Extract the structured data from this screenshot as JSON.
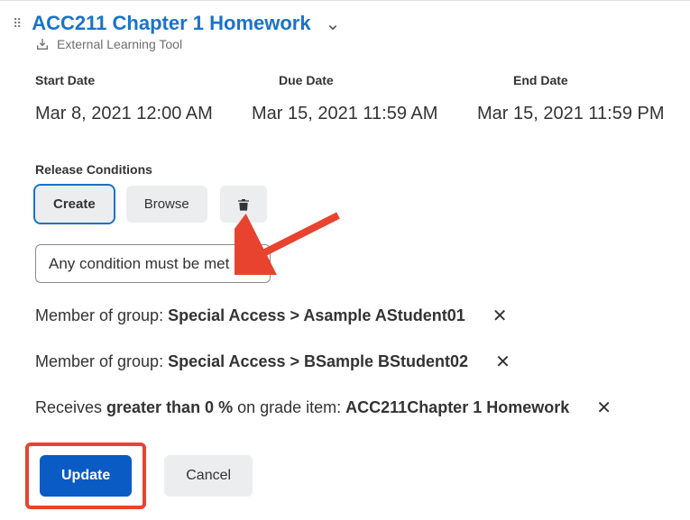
{
  "header": {
    "title": "ACC211 Chapter 1 Homework",
    "subtype": "External Learning Tool"
  },
  "dates": {
    "start_label": "Start Date",
    "due_label": "Due Date",
    "end_label": "End Date",
    "start_value": "Mar 8, 2021 12:00 AM",
    "due_value": "Mar 15, 2021 11:59 AM",
    "end_value": "Mar 15, 2021 11:59 PM"
  },
  "release": {
    "label": "Release Conditions",
    "create_label": "Create",
    "browse_label": "Browse",
    "dropdown_value": "Any condition must be met",
    "conditions": [
      {
        "prefix": "Member of group: ",
        "bold": "Special Access > Asample AStudent01"
      },
      {
        "prefix": "Member of group: ",
        "bold": "Special Access > BSample BStudent02"
      },
      {
        "prefix": "Receives ",
        "bold": "greater than 0 %",
        "mid": " on grade item: ",
        "bold2": "ACC211Chapter 1 Homework"
      }
    ]
  },
  "footer": {
    "update_label": "Update",
    "cancel_label": "Cancel"
  }
}
